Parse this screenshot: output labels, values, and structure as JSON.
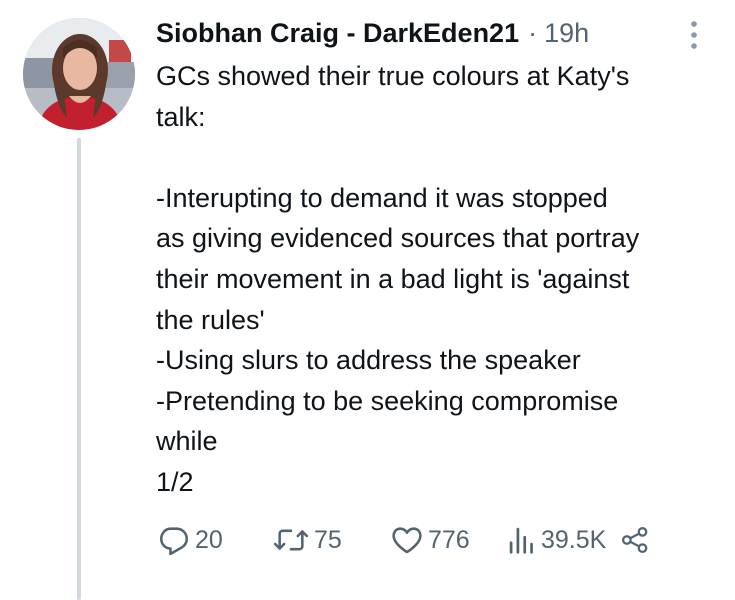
{
  "tweet": {
    "author_name": "Siobhan Craig - DarkEden21",
    "separator": "·",
    "time": "19h",
    "lines": [
      "GCs showed their true colours at Katy's",
      "talk:",
      "",
      "-Interupting to demand it was stopped",
      "as giving evidenced sources that portray",
      "their movement in a bad light is 'against",
      "the rules'",
      "-Using slurs to address the speaker",
      "-Pretending to be seeking compromise",
      "while",
      "1/2"
    ]
  },
  "actions": {
    "replies": "20",
    "retweets": "75",
    "likes": "776",
    "views": "39.5K"
  },
  "icons": {
    "more": "more-vertical-icon",
    "reply": "reply-icon",
    "retweet": "retweet-icon",
    "like": "heart-icon",
    "views": "views-bar-chart-icon",
    "share": "share-icon"
  },
  "colors": {
    "text": "#0f1419",
    "secondary": "#536471",
    "thread_line": "#cfd9de"
  }
}
